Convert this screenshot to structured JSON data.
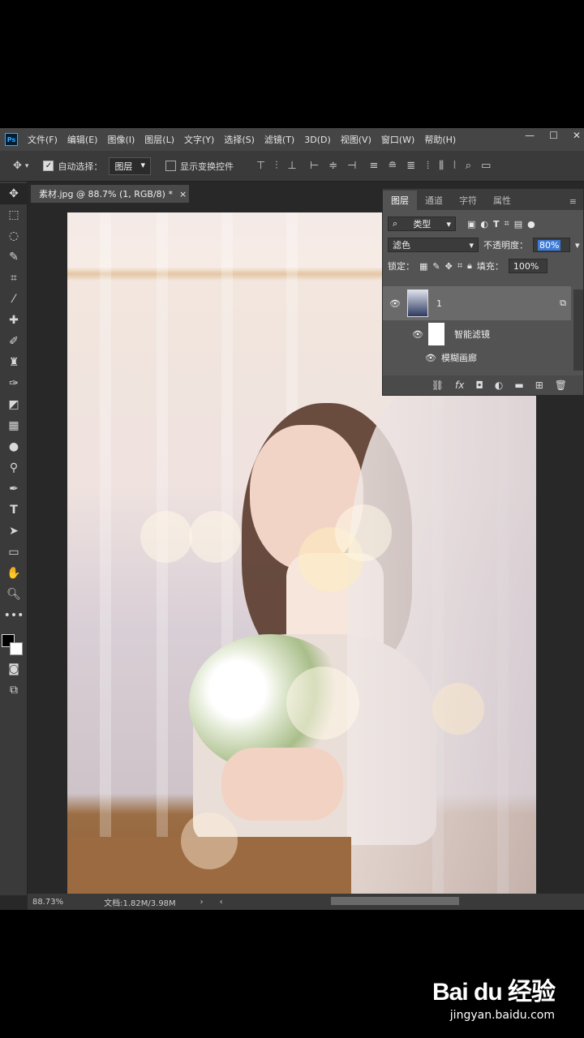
{
  "menu": {
    "logo": "Ps",
    "items": [
      "文件(F)",
      "编辑(E)",
      "图像(I)",
      "图层(L)",
      "文字(Y)",
      "选择(S)",
      "滤镜(T)",
      "3D(D)",
      "视图(V)",
      "窗口(W)",
      "帮助(H)"
    ]
  },
  "options": {
    "auto_select_label": "自动选择：",
    "auto_select_value": "图层",
    "show_transform_label": "显示变换控件"
  },
  "document": {
    "tab_title": "素材.jpg @ 88.7% (1, RGB/8) *",
    "close_glyph": "×"
  },
  "layers_panel": {
    "tabs": [
      "图层",
      "通道",
      "字符",
      "属性"
    ],
    "filter_kind": "类型",
    "blend_mode": "滤色",
    "opacity_label": "不透明度：",
    "opacity_value": "80%",
    "lock_label": "锁定：",
    "fill_label": "填充：",
    "fill_value": "100%",
    "layer_name": "1",
    "smart_filters_label": "智能滤镜",
    "filter_name": "模糊画廊"
  },
  "status": {
    "zoom": "88.73%",
    "doc_info": "文档:1.82M/3.98M"
  },
  "watermark": {
    "logo_text": "Bai du 经验",
    "url": "jingyan.baidu.com"
  }
}
